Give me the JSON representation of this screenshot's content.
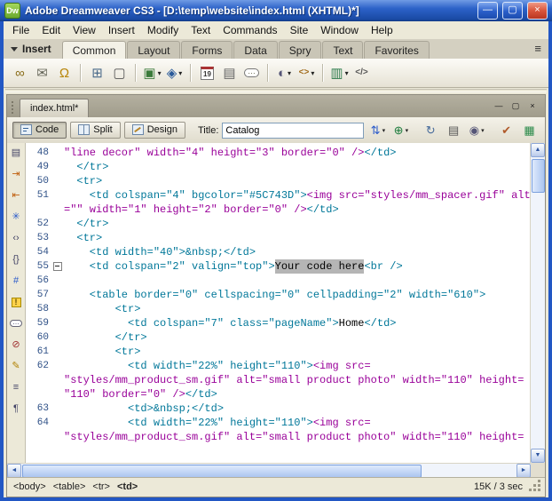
{
  "window": {
    "app_icon_text": "Dw",
    "title": "Adobe Dreamweaver CS3 - [D:\\temp\\website\\index.html (XHTML)*]",
    "controls": {
      "minimize": "—",
      "maximize": "▢",
      "close": "×"
    }
  },
  "menu_bar": {
    "items": [
      "File",
      "Edit",
      "View",
      "Insert",
      "Modify",
      "Text",
      "Commands",
      "Site",
      "Window",
      "Help"
    ]
  },
  "insert_bar": {
    "label": "Insert",
    "menu_icon": "≡",
    "tabs": [
      {
        "label": "Common",
        "active": true
      },
      {
        "label": "Layout"
      },
      {
        "label": "Forms"
      },
      {
        "label": "Data"
      },
      {
        "label": "Spry"
      },
      {
        "label": "Text"
      },
      {
        "label": "Favorites"
      }
    ],
    "icons": [
      {
        "name": "hyperlink-icon",
        "glyph": "∞",
        "color": "#8a6d1a"
      },
      {
        "name": "email-link-icon",
        "glyph": "✉",
        "color": "#67675a"
      },
      {
        "name": "named-anchor-icon",
        "glyph": "Ω",
        "color": "#b8860b"
      },
      {
        "sep": true
      },
      {
        "name": "table-icon",
        "glyph": "⊞",
        "color": "#4a6a8a"
      },
      {
        "name": "insert-div-icon",
        "glyph": "▢",
        "color": "#555555"
      },
      {
        "sep": true
      },
      {
        "name": "images-icon",
        "glyph": "▣",
        "color": "#3a7a3a",
        "dropdown": true
      },
      {
        "name": "media-icon",
        "glyph": "◈",
        "color": "#2a5a9a",
        "dropdown": true
      },
      {
        "sep": true
      },
      {
        "name": "date-icon",
        "glyph": "19",
        "color": "#333333",
        "style": "cal"
      },
      {
        "name": "server-side-include-icon",
        "glyph": "▤",
        "color": "#666666"
      },
      {
        "name": "comment-icon",
        "glyph": "…",
        "color": "#6a6a50",
        "style": "bub"
      },
      {
        "sep": true
      },
      {
        "name": "head-icon",
        "glyph": "◐",
        "color": "#555577",
        "dropdown": true
      },
      {
        "name": "script-icon",
        "glyph": "<>",
        "color": "#a06a1a",
        "dropdown": true,
        "style": "sm"
      },
      {
        "sep": true
      },
      {
        "name": "templates-icon",
        "glyph": "▥",
        "color": "#2a7a4a",
        "dropdown": true
      },
      {
        "name": "tag-chooser-icon",
        "glyph": "</>",
        "color": "#555555",
        "style": "sm"
      }
    ]
  },
  "document": {
    "tab_label": "index.html*",
    "doc_controls": {
      "minimize": "—",
      "restore": "▢",
      "close": "×"
    },
    "toolbar": {
      "code_label": "Code",
      "split_label": "Split",
      "design_label": "Design",
      "title_label": "Title:",
      "title_value": "Catalog",
      "icons": [
        {
          "name": "file-management-icon",
          "glyph": "⇅",
          "color": "#2a5aca",
          "dropdown": true
        },
        {
          "name": "preview-in-browser-icon",
          "glyph": "⊕",
          "color": "#1a7a3a",
          "dropdown": true
        },
        {
          "gap": true
        },
        {
          "name": "refresh-icon",
          "glyph": "↻",
          "color": "#44699a"
        },
        {
          "name": "view-options-icon",
          "glyph": "▤",
          "color": "#555555"
        },
        {
          "name": "visual-aids-icon",
          "glyph": "◉",
          "color": "#555577",
          "dropdown": true
        },
        {
          "gap": true
        },
        {
          "name": "validate-markup-icon",
          "glyph": "✔",
          "color": "#b05a2a"
        },
        {
          "name": "check-browser-compatibility-icon",
          "glyph": "▦",
          "color": "#2a8a4a"
        }
      ]
    }
  },
  "coding_toolbar": {
    "icons": [
      {
        "name": "open-documents-icon",
        "glyph": "▤",
        "color": "#444466"
      },
      {
        "name": "collapse-full-tag-icon",
        "glyph": "⇥",
        "color": "#c06010"
      },
      {
        "name": "collapse-selection-icon",
        "glyph": "⇤",
        "color": "#c06010"
      },
      {
        "name": "expand-all-icon",
        "glyph": "✳",
        "color": "#2a5aca"
      },
      {
        "name": "select-parent-tag-icon",
        "glyph": "‹›",
        "color": "#444466"
      },
      {
        "name": "balance-braces-icon",
        "glyph": "{}",
        "color": "#444466"
      },
      {
        "name": "line-numbers-icon",
        "glyph": "#",
        "color": "#2a5aca"
      },
      {
        "name": "highlight-invalid-code-icon",
        "glyph": "!",
        "color": "#5a4a00",
        "style": "warn"
      },
      {
        "name": "apply-comment-icon",
        "glyph": "…",
        "color": "#444466",
        "style": "bub2"
      },
      {
        "name": "remove-comment-icon",
        "glyph": "⊘",
        "color": "#a03030"
      },
      {
        "name": "recent-snippets-icon",
        "glyph": "✎",
        "color": "#b08000"
      },
      {
        "name": "indent-code-icon",
        "glyph": "≡",
        "color": "#444466"
      },
      {
        "name": "format-source-code-icon",
        "glyph": "¶",
        "color": "#444466"
      }
    ]
  },
  "code": {
    "colors": {
      "tag": "#007799",
      "img": "#990099",
      "text": "#000000",
      "selection_bg": "#b5b5b5",
      "line_number": "#2d4f86"
    },
    "rows": [
      {
        "n": "48",
        "segs": [
          [
            "i",
            "\"line decor\" width=\"4\" height=\"3\" border=\"0\" />"
          ],
          [
            "t",
            "</td>"
          ]
        ]
      },
      {
        "n": "49",
        "segs": [
          [
            "t",
            "  </tr>"
          ]
        ]
      },
      {
        "n": "50",
        "segs": [
          [
            "t",
            "  <tr>"
          ]
        ]
      },
      {
        "n": "51",
        "segs": [
          [
            "t",
            "    <td colspan=\"4\" bgcolor=\"#5C743D\">"
          ],
          [
            "i",
            "<img src=\"styles/mm_spacer.gif\" alt"
          ]
        ]
      },
      {
        "n": "",
        "segs": [
          [
            "i",
            "=\"\" width=\"1\" height=\"2\" border=\"0\" />"
          ],
          [
            "t",
            "</td>"
          ]
        ]
      },
      {
        "n": "52",
        "segs": [
          [
            "t",
            "  </tr>"
          ]
        ]
      },
      {
        "n": "53",
        "segs": [
          [
            "t",
            "  <tr>"
          ]
        ]
      },
      {
        "n": "54",
        "segs": [
          [
            "t",
            "    <td width=\"40\">&nbsp;</td>"
          ]
        ]
      },
      {
        "n": "55",
        "fold": true,
        "segs": [
          [
            "t",
            "    <td colspan=\"2\" valign=\"top\">"
          ],
          [
            "s",
            "Your code here"
          ],
          [
            "t",
            "<br />"
          ]
        ]
      },
      {
        "n": "56",
        "segs": []
      },
      {
        "n": "57",
        "segs": [
          [
            "t",
            "    <table border=\"0\" cellspacing=\"0\" cellpadding=\"2\" width=\"610\">"
          ]
        ]
      },
      {
        "n": "58",
        "segs": [
          [
            "t",
            "        <tr>"
          ]
        ]
      },
      {
        "n": "59",
        "segs": [
          [
            "t",
            "          <td colspan=\"7\" class=\"pageName\">"
          ],
          [
            "k",
            "Home"
          ],
          [
            "t",
            "</td>"
          ]
        ]
      },
      {
        "n": "60",
        "segs": [
          [
            "t",
            "        </tr>"
          ]
        ]
      },
      {
        "n": "61",
        "segs": [
          [
            "t",
            "        <tr>"
          ]
        ]
      },
      {
        "n": "62",
        "segs": [
          [
            "t",
            "          <td width=\"22%\" height=\"110\">"
          ],
          [
            "i",
            "<img src="
          ]
        ]
      },
      {
        "n": "",
        "segs": [
          [
            "i",
            "\"styles/mm_product_sm.gif\" alt=\"small product photo\" width=\"110\" height="
          ]
        ]
      },
      {
        "n": "",
        "segs": [
          [
            "i",
            "\"110\" border=\"0\" />"
          ],
          [
            "t",
            "</td>"
          ]
        ]
      },
      {
        "n": "63",
        "segs": [
          [
            "t",
            "          <td>&nbsp;</td>"
          ]
        ]
      },
      {
        "n": "64",
        "segs": [
          [
            "t",
            "          <td width=\"22%\" height=\"110\">"
          ],
          [
            "i",
            "<img src="
          ]
        ]
      },
      {
        "n": "",
        "segs": [
          [
            "i",
            "\"styles/mm_product_sm.gif\" alt=\"small product photo\" width=\"110\" height="
          ]
        ]
      }
    ]
  },
  "status_bar": {
    "tags": [
      "<body>",
      "<table>",
      "<tr>",
      "<td>"
    ],
    "info": "15K / 3 sec"
  },
  "scrollbars": {
    "up": "▲",
    "down": "▼",
    "left": "◄",
    "right": "►"
  }
}
